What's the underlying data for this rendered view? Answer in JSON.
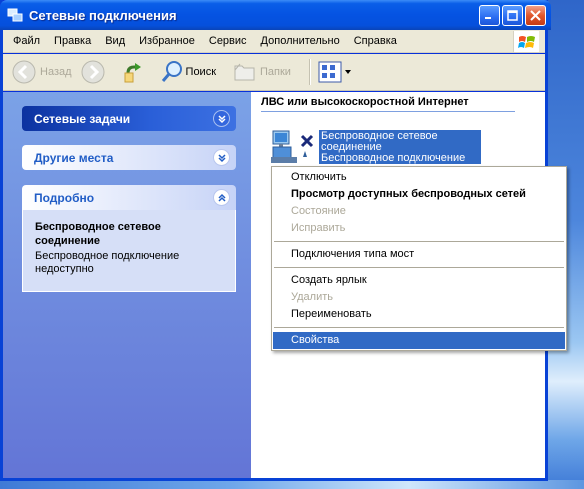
{
  "window": {
    "title": "Сетевые подключения",
    "title_icon": "network-connections-icon"
  },
  "menubar": {
    "items": [
      "Файл",
      "Правка",
      "Вид",
      "Избранное",
      "Сервис",
      "Дополнительно",
      "Справка"
    ]
  },
  "toolbar": {
    "back_label": "Назад",
    "search_label": "Поиск",
    "folders_label": "Папки"
  },
  "left_pane": {
    "network_tasks": "Сетевые задачи",
    "other_places": "Другие места",
    "details": {
      "header": "Подробно",
      "name": "Беспроводное сетевое соединение",
      "status": "Беспроводное подключение недоступно"
    }
  },
  "right_pane": {
    "group_heading": "ЛВС или высокоскоростной Интернет",
    "connection": {
      "name_line1": "Беспроводное сетевое",
      "name_line2": "соединение",
      "status_line": "Беспроводное подключение"
    }
  },
  "context_menu": {
    "items": [
      {
        "label": "Отключить",
        "style": "normal"
      },
      {
        "label": "Просмотр доступных беспроводных сетей",
        "style": "bold"
      },
      {
        "label": "Состояние",
        "style": "disabled"
      },
      {
        "label": "Исправить",
        "style": "disabled"
      },
      {
        "label": "Подключения типа мост",
        "style": "normal"
      },
      {
        "label": "Создать ярлык",
        "style": "normal"
      },
      {
        "label": "Удалить",
        "style": "disabled"
      },
      {
        "label": "Переименовать",
        "style": "normal"
      },
      {
        "label": "Свойства",
        "style": "highlighted"
      }
    ]
  },
  "colors": {
    "titlebar": "#0553e2",
    "selection": "#316ac5",
    "task_pane_top": "#7ba2e7",
    "task_pane_bottom": "#6375d6"
  }
}
